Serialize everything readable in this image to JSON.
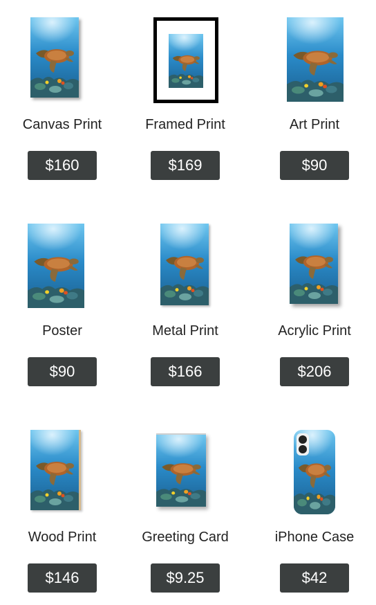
{
  "products": [
    {
      "id": "canvas-print",
      "label": "Canvas Print",
      "price": "$160"
    },
    {
      "id": "framed-print",
      "label": "Framed Print",
      "price": "$169"
    },
    {
      "id": "art-print",
      "label": "Art Print",
      "price": "$90"
    },
    {
      "id": "poster",
      "label": "Poster",
      "price": "$90"
    },
    {
      "id": "metal-print",
      "label": "Metal Print",
      "price": "$166"
    },
    {
      "id": "acrylic-print",
      "label": "Acrylic Print",
      "price": "$206"
    },
    {
      "id": "wood-print",
      "label": "Wood Print",
      "price": "$146"
    },
    {
      "id": "greeting-card",
      "label": "Greeting Card",
      "price": "$9.25"
    },
    {
      "id": "iphone-case",
      "label": "iPhone Case",
      "price": "$42"
    }
  ],
  "colors": {
    "price_button_bg": "#3b3f3f",
    "price_button_text": "#ffffff",
    "label_text": "#222222"
  },
  "artwork_icon": "sea-turtle-underwater-artwork"
}
